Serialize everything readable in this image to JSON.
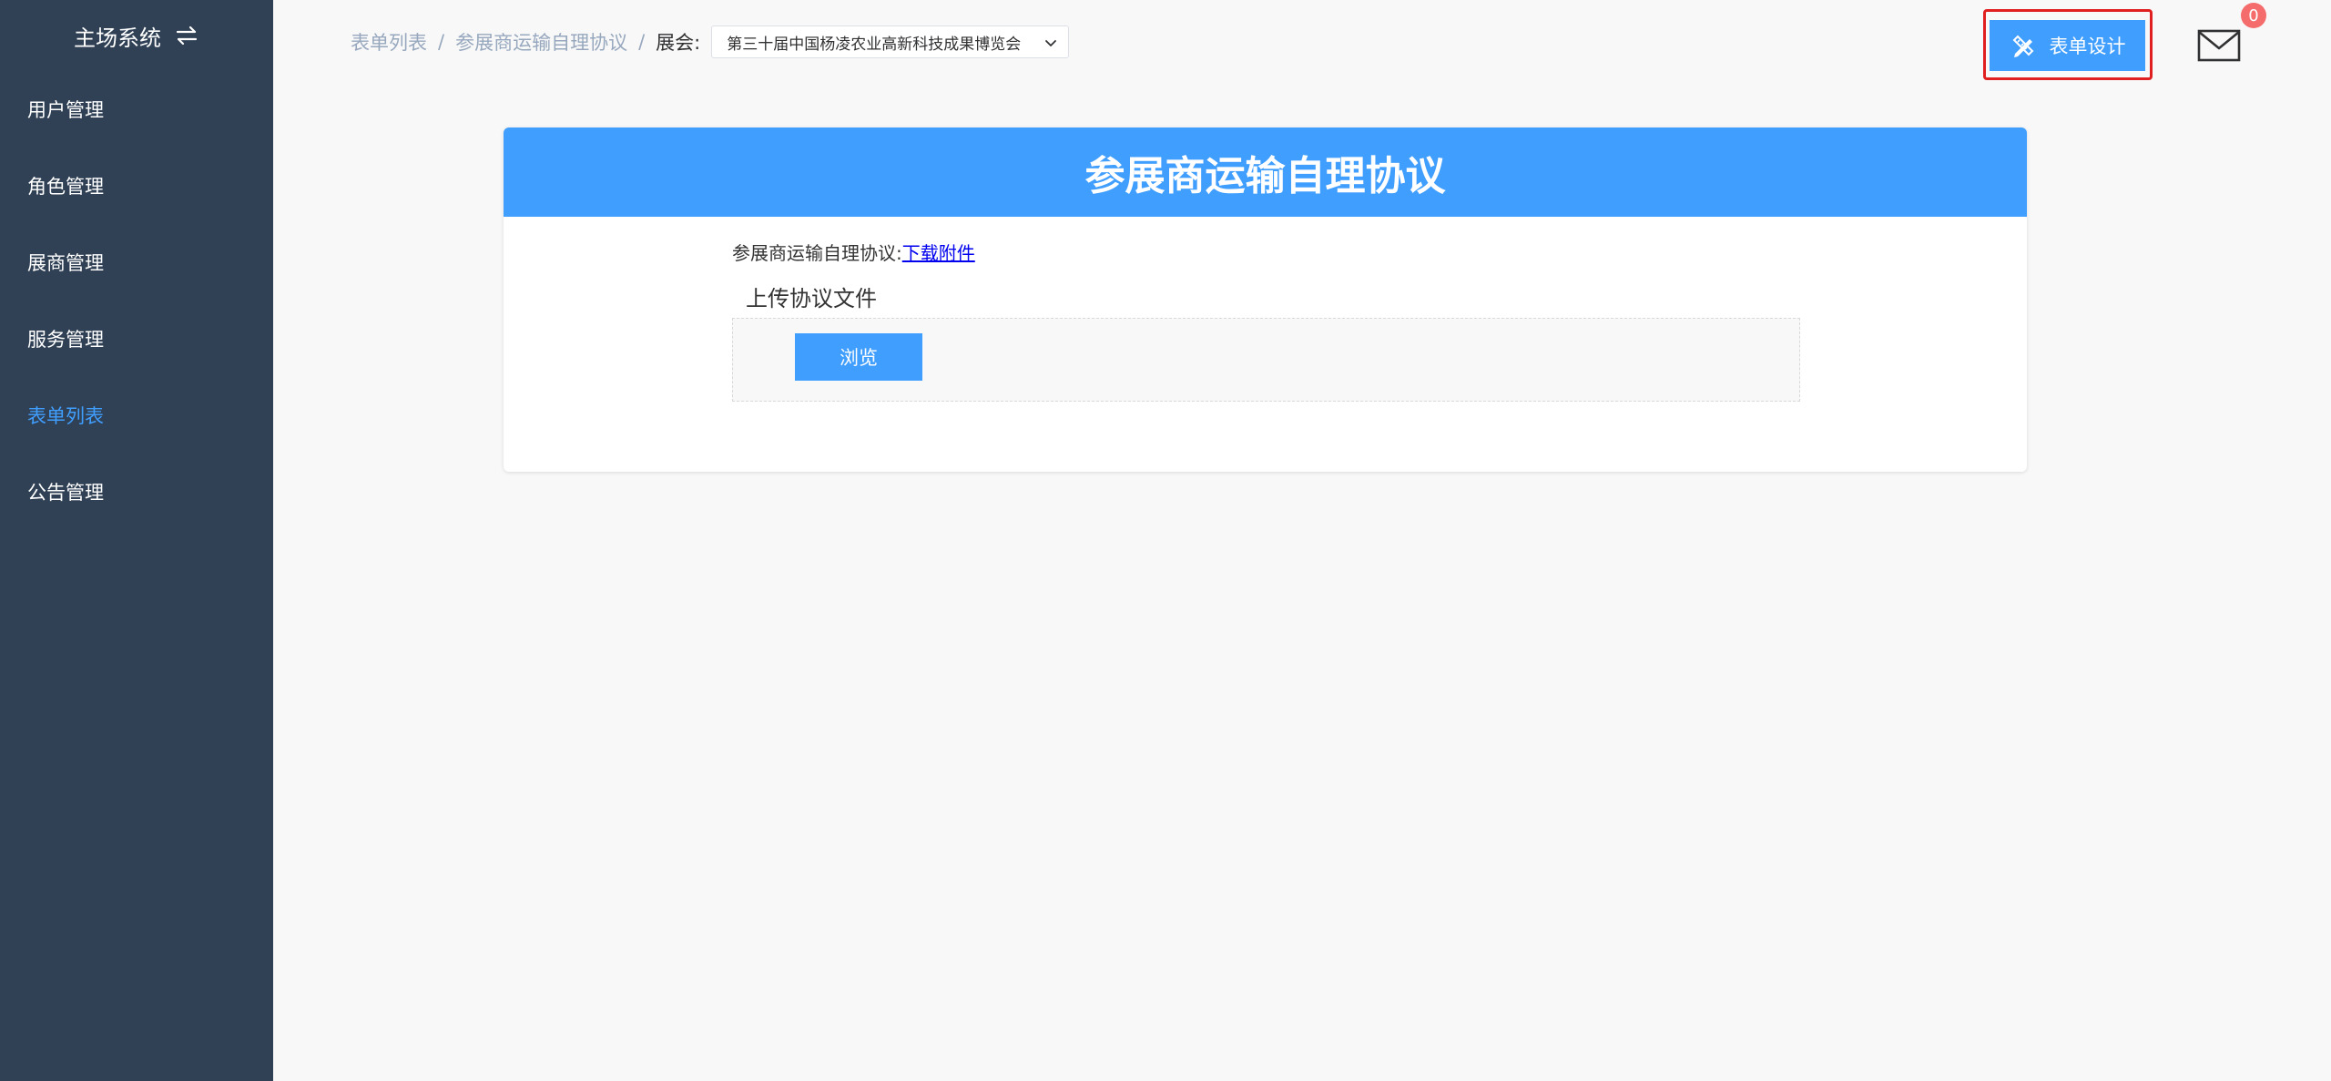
{
  "sidebar": {
    "system_title": "主场系统",
    "items": [
      {
        "label": "用户管理",
        "active": false
      },
      {
        "label": "角色管理",
        "active": false
      },
      {
        "label": "展商管理",
        "active": false
      },
      {
        "label": "服务管理",
        "active": false
      },
      {
        "label": "表单列表",
        "active": true
      },
      {
        "label": "公告管理",
        "active": false
      }
    ]
  },
  "header": {
    "breadcrumb": [
      "表单列表",
      "参展商运输自理协议"
    ],
    "separator": "/",
    "expo_label": "展会:",
    "expo_selected": "第三十届中国杨凌农业高新科技成果博览会",
    "design_button": "表单设计",
    "mail_badge": "0"
  },
  "card": {
    "title": "参展商运输自理协议",
    "agreement_label": "参展商运输自理协议:",
    "download_link": "下载附件",
    "upload_title": "上传协议文件",
    "browse_button": "浏览"
  },
  "icons": {
    "swap": "swap-arrows-icon",
    "design": "pencil-ruler-icon",
    "mail": "mail-icon",
    "select": "chevron-down-icon"
  },
  "colors": {
    "sidebar_bg": "#304156",
    "primary": "#409eff",
    "highlight": "#e02020",
    "badge": "#f56c6c"
  }
}
